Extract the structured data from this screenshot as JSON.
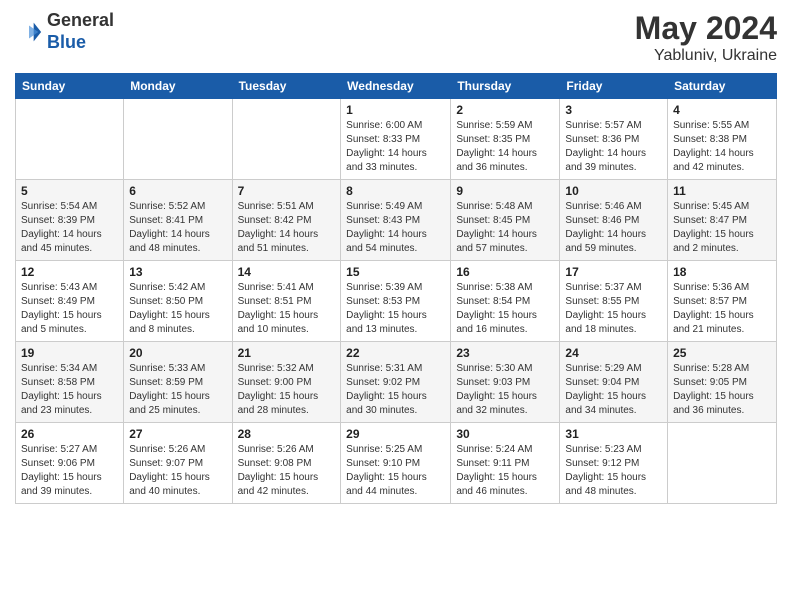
{
  "header": {
    "logo_general": "General",
    "logo_blue": "Blue",
    "month_title": "May 2024",
    "location": "Yabluniv, Ukraine"
  },
  "days_of_week": [
    "Sunday",
    "Monday",
    "Tuesday",
    "Wednesday",
    "Thursday",
    "Friday",
    "Saturday"
  ],
  "weeks": [
    {
      "days": [
        {
          "num": "",
          "info": ""
        },
        {
          "num": "",
          "info": ""
        },
        {
          "num": "",
          "info": ""
        },
        {
          "num": "1",
          "info": "Sunrise: 6:00 AM\nSunset: 8:33 PM\nDaylight: 14 hours\nand 33 minutes."
        },
        {
          "num": "2",
          "info": "Sunrise: 5:59 AM\nSunset: 8:35 PM\nDaylight: 14 hours\nand 36 minutes."
        },
        {
          "num": "3",
          "info": "Sunrise: 5:57 AM\nSunset: 8:36 PM\nDaylight: 14 hours\nand 39 minutes."
        },
        {
          "num": "4",
          "info": "Sunrise: 5:55 AM\nSunset: 8:38 PM\nDaylight: 14 hours\nand 42 minutes."
        }
      ]
    },
    {
      "days": [
        {
          "num": "5",
          "info": "Sunrise: 5:54 AM\nSunset: 8:39 PM\nDaylight: 14 hours\nand 45 minutes."
        },
        {
          "num": "6",
          "info": "Sunrise: 5:52 AM\nSunset: 8:41 PM\nDaylight: 14 hours\nand 48 minutes."
        },
        {
          "num": "7",
          "info": "Sunrise: 5:51 AM\nSunset: 8:42 PM\nDaylight: 14 hours\nand 51 minutes."
        },
        {
          "num": "8",
          "info": "Sunrise: 5:49 AM\nSunset: 8:43 PM\nDaylight: 14 hours\nand 54 minutes."
        },
        {
          "num": "9",
          "info": "Sunrise: 5:48 AM\nSunset: 8:45 PM\nDaylight: 14 hours\nand 57 minutes."
        },
        {
          "num": "10",
          "info": "Sunrise: 5:46 AM\nSunset: 8:46 PM\nDaylight: 14 hours\nand 59 minutes."
        },
        {
          "num": "11",
          "info": "Sunrise: 5:45 AM\nSunset: 8:47 PM\nDaylight: 15 hours\nand 2 minutes."
        }
      ]
    },
    {
      "days": [
        {
          "num": "12",
          "info": "Sunrise: 5:43 AM\nSunset: 8:49 PM\nDaylight: 15 hours\nand 5 minutes."
        },
        {
          "num": "13",
          "info": "Sunrise: 5:42 AM\nSunset: 8:50 PM\nDaylight: 15 hours\nand 8 minutes."
        },
        {
          "num": "14",
          "info": "Sunrise: 5:41 AM\nSunset: 8:51 PM\nDaylight: 15 hours\nand 10 minutes."
        },
        {
          "num": "15",
          "info": "Sunrise: 5:39 AM\nSunset: 8:53 PM\nDaylight: 15 hours\nand 13 minutes."
        },
        {
          "num": "16",
          "info": "Sunrise: 5:38 AM\nSunset: 8:54 PM\nDaylight: 15 hours\nand 16 minutes."
        },
        {
          "num": "17",
          "info": "Sunrise: 5:37 AM\nSunset: 8:55 PM\nDaylight: 15 hours\nand 18 minutes."
        },
        {
          "num": "18",
          "info": "Sunrise: 5:36 AM\nSunset: 8:57 PM\nDaylight: 15 hours\nand 21 minutes."
        }
      ]
    },
    {
      "days": [
        {
          "num": "19",
          "info": "Sunrise: 5:34 AM\nSunset: 8:58 PM\nDaylight: 15 hours\nand 23 minutes."
        },
        {
          "num": "20",
          "info": "Sunrise: 5:33 AM\nSunset: 8:59 PM\nDaylight: 15 hours\nand 25 minutes."
        },
        {
          "num": "21",
          "info": "Sunrise: 5:32 AM\nSunset: 9:00 PM\nDaylight: 15 hours\nand 28 minutes."
        },
        {
          "num": "22",
          "info": "Sunrise: 5:31 AM\nSunset: 9:02 PM\nDaylight: 15 hours\nand 30 minutes."
        },
        {
          "num": "23",
          "info": "Sunrise: 5:30 AM\nSunset: 9:03 PM\nDaylight: 15 hours\nand 32 minutes."
        },
        {
          "num": "24",
          "info": "Sunrise: 5:29 AM\nSunset: 9:04 PM\nDaylight: 15 hours\nand 34 minutes."
        },
        {
          "num": "25",
          "info": "Sunrise: 5:28 AM\nSunset: 9:05 PM\nDaylight: 15 hours\nand 36 minutes."
        }
      ]
    },
    {
      "days": [
        {
          "num": "26",
          "info": "Sunrise: 5:27 AM\nSunset: 9:06 PM\nDaylight: 15 hours\nand 39 minutes."
        },
        {
          "num": "27",
          "info": "Sunrise: 5:26 AM\nSunset: 9:07 PM\nDaylight: 15 hours\nand 40 minutes."
        },
        {
          "num": "28",
          "info": "Sunrise: 5:26 AM\nSunset: 9:08 PM\nDaylight: 15 hours\nand 42 minutes."
        },
        {
          "num": "29",
          "info": "Sunrise: 5:25 AM\nSunset: 9:10 PM\nDaylight: 15 hours\nand 44 minutes."
        },
        {
          "num": "30",
          "info": "Sunrise: 5:24 AM\nSunset: 9:11 PM\nDaylight: 15 hours\nand 46 minutes."
        },
        {
          "num": "31",
          "info": "Sunrise: 5:23 AM\nSunset: 9:12 PM\nDaylight: 15 hours\nand 48 minutes."
        },
        {
          "num": "",
          "info": ""
        }
      ]
    }
  ]
}
